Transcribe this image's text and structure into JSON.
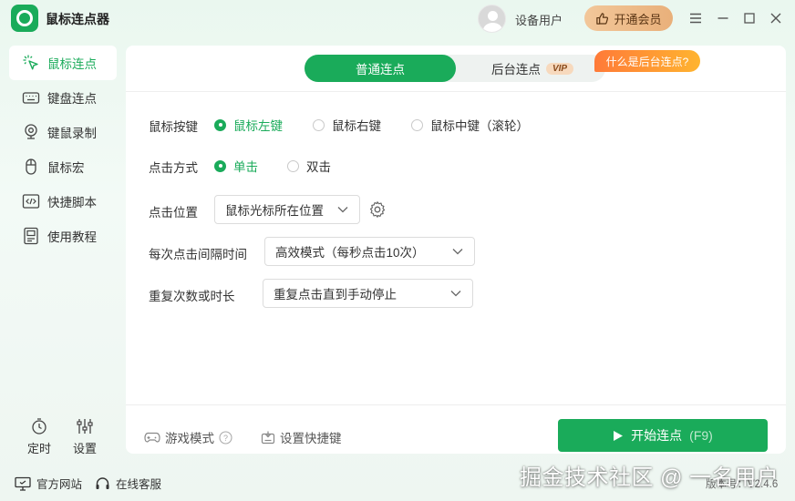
{
  "app": {
    "title": "鼠标连点器",
    "user_name": "设备用户",
    "vip_button": "开通会员"
  },
  "sidebar": {
    "items": [
      {
        "label": "鼠标连点",
        "icon": "mouse-click-icon"
      },
      {
        "label": "键盘连点",
        "icon": "keyboard-icon"
      },
      {
        "label": "键鼠录制",
        "icon": "record-icon"
      },
      {
        "label": "鼠标宏",
        "icon": "mouse-icon"
      },
      {
        "label": "快捷脚本",
        "icon": "script-icon"
      },
      {
        "label": "使用教程",
        "icon": "tutorial-icon"
      }
    ],
    "timer_label": "定时",
    "settings_label": "设置"
  },
  "tabs": {
    "normal": "普通连点",
    "background": "后台连点",
    "vip_tag": "VIP",
    "bubble": "什么是后台连点?"
  },
  "form": {
    "button_label": "鼠标按键",
    "button_options": [
      "鼠标左键",
      "鼠标右键",
      "鼠标中键（滚轮）"
    ],
    "click_type_label": "点击方式",
    "click_type_options": [
      "单击",
      "双击"
    ],
    "position_label": "点击位置",
    "position_value": "鼠标光标所在位置",
    "interval_label": "每次点击间隔时间",
    "interval_value": "高效模式（每秒点击10次）",
    "repeat_label": "重复次数或时长",
    "repeat_value": "重复点击直到手动停止"
  },
  "footer": {
    "game_mode": "游戏模式",
    "hotkey": "设置快捷键",
    "start": "开始连点",
    "start_hotkey": "(F9)"
  },
  "bottom": {
    "website": "官方网站",
    "support": "在线客服",
    "version": "版本号：V2.4.6",
    "watermark": "掘金技术社区 @ 一名用户"
  },
  "colors": {
    "accent": "#1aab5a",
    "vip": "#e9b07a",
    "bubble": "#ff7a38"
  }
}
